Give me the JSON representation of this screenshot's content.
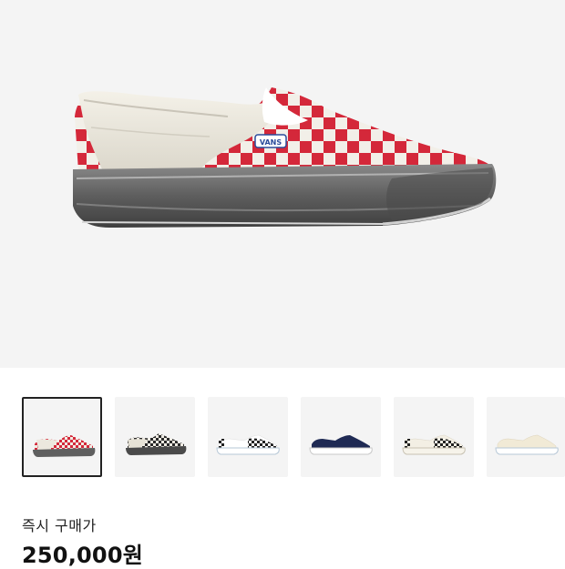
{
  "product": {
    "image_alt_icon": "slip-on-shoe-image",
    "brand_mark": "VANS"
  },
  "thumbnails": [
    {
      "icon": "red-checker-slip-on-thumbnail",
      "selected": true
    },
    {
      "icon": "black-checker-slip-on-thumbnail",
      "selected": false
    },
    {
      "icon": "white-black-checker-slip-on-thumbnail",
      "selected": false
    },
    {
      "icon": "navy-slip-on-thumbnail",
      "selected": false
    },
    {
      "icon": "cream-checker-slip-on-thumbnail",
      "selected": false
    },
    {
      "icon": "cream-slip-on-thumbnail",
      "selected": false
    }
  ],
  "price": {
    "label": "즉시 구매가",
    "value": "250,000원"
  },
  "colors": {
    "hero_bg": "#f4f4f4",
    "checker_red": "#d4283a",
    "sole_gray": "#5e5e5e",
    "selected_border": "#222222"
  }
}
